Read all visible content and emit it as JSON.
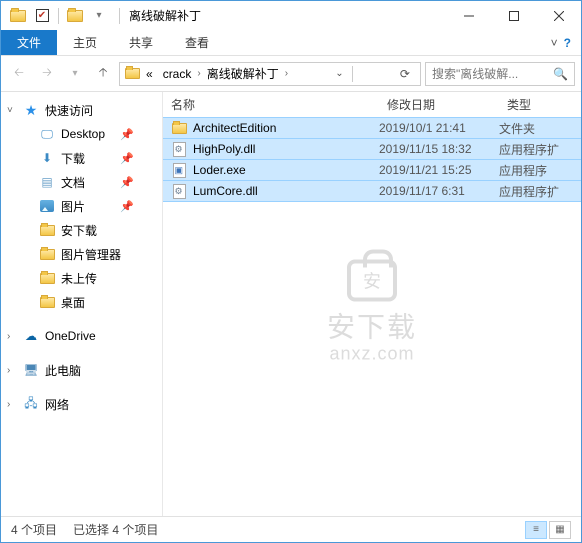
{
  "window": {
    "title": "离线破解补丁"
  },
  "ribbon": {
    "file": "文件",
    "tabs": [
      "主页",
      "共享",
      "查看"
    ]
  },
  "breadcrumb": {
    "prefix": "«",
    "segs": [
      "crack",
      "离线破解补丁"
    ]
  },
  "search": {
    "placeholder": "搜索\"离线破解..."
  },
  "sidebar": {
    "quick": {
      "label": "快速访问"
    },
    "items": [
      {
        "label": "Desktop",
        "pinned": true,
        "icon": "desk"
      },
      {
        "label": "下载",
        "pinned": true,
        "icon": "down"
      },
      {
        "label": "文档",
        "pinned": true,
        "icon": "doc"
      },
      {
        "label": "图片",
        "pinned": true,
        "icon": "pic"
      },
      {
        "label": "安下载",
        "pinned": false,
        "icon": "folder"
      },
      {
        "label": "图片管理器",
        "pinned": false,
        "icon": "folder"
      },
      {
        "label": "未上传",
        "pinned": false,
        "icon": "folder"
      },
      {
        "label": "桌面",
        "pinned": false,
        "icon": "folder"
      }
    ],
    "onedrive": "OneDrive",
    "thispc": "此电脑",
    "network": "网络"
  },
  "columns": {
    "name": "名称",
    "date": "修改日期",
    "type": "类型"
  },
  "files": [
    {
      "name": "ArchitectEdition",
      "date": "2019/10/1 21:41",
      "type": "文件夹",
      "icon": "folder"
    },
    {
      "name": "HighPoly.dll",
      "date": "2019/11/15 18:32",
      "type": "应用程序扩",
      "icon": "dll"
    },
    {
      "name": "Loder.exe",
      "date": "2019/11/21 15:25",
      "type": "应用程序",
      "icon": "exe"
    },
    {
      "name": "LumCore.dll",
      "date": "2019/11/17 6:31",
      "type": "应用程序扩",
      "icon": "dll"
    }
  ],
  "status": {
    "count": "4 个项目",
    "selected": "已选择 4 个项目"
  },
  "watermark": {
    "line1": "安下载",
    "line2": "anxz.com"
  }
}
